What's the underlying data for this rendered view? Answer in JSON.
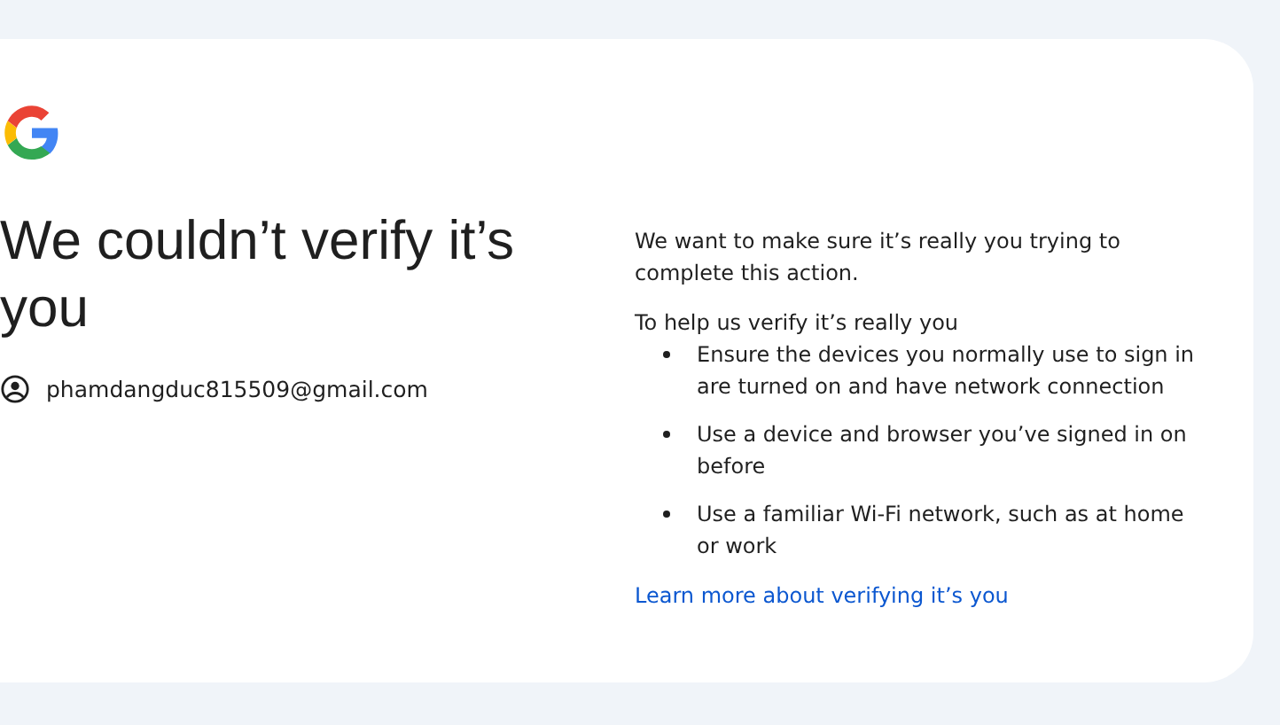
{
  "heading": "We couldn’t verify it’s you",
  "account": {
    "email": "phamdangduc815509@gmail.com"
  },
  "intro": "We want to make sure it’s really you trying to complete this action.",
  "tips_title": "To help us verify it’s really you",
  "tips": [
    "Ensure the devices you normally use to sign in are turned on and have network connection",
    "Use a device and browser you’ve signed in on before",
    "Use a familiar Wi-Fi network, such as at home or work"
  ],
  "link": "Learn more about verifying it’s you"
}
